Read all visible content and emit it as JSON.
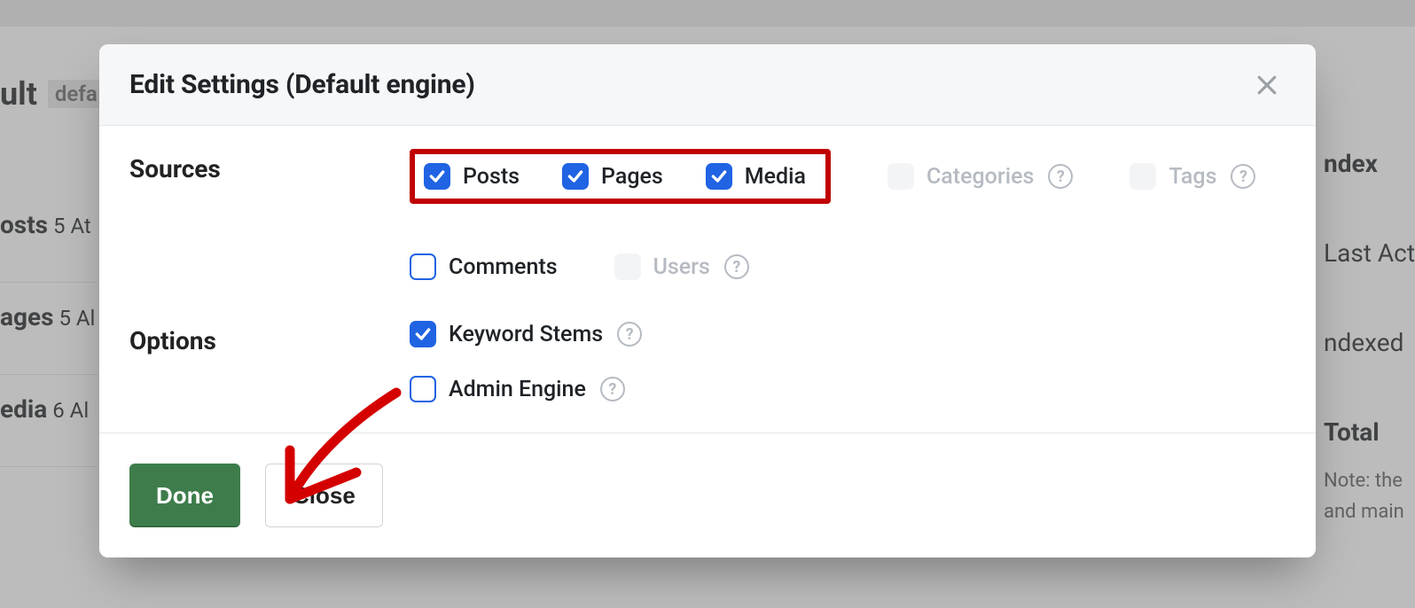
{
  "background": {
    "title_suffix": "ult",
    "badge": "defa",
    "list": [
      {
        "label": "osts",
        "meta": "5 At"
      },
      {
        "label": "ages",
        "meta": "5 Al"
      },
      {
        "label": "edia",
        "meta": "6 Al"
      }
    ],
    "right": {
      "l1": "ndex",
      "l2": "Last Act",
      "l3": "ndexed",
      "l4": "Total",
      "note1": "Note: the",
      "note2": "and main"
    }
  },
  "modal": {
    "title": "Edit Settings (Default engine)",
    "sections": {
      "sources_label": "Sources",
      "options_label": "Options"
    },
    "sources": {
      "posts": {
        "label": "Posts",
        "checked": true,
        "disabled": false,
        "help": false
      },
      "pages": {
        "label": "Pages",
        "checked": true,
        "disabled": false,
        "help": false
      },
      "media": {
        "label": "Media",
        "checked": true,
        "disabled": false,
        "help": false
      },
      "categories": {
        "label": "Categories",
        "checked": false,
        "disabled": true,
        "help": true
      },
      "tags": {
        "label": "Tags",
        "checked": false,
        "disabled": true,
        "help": true
      },
      "comments": {
        "label": "Comments",
        "checked": false,
        "disabled": false,
        "help": false
      },
      "users": {
        "label": "Users",
        "checked": false,
        "disabled": true,
        "help": true
      }
    },
    "options": {
      "keyword_stems": {
        "label": "Keyword Stems",
        "checked": true,
        "help": true
      },
      "admin_engine": {
        "label": "Admin Engine",
        "checked": false,
        "help": true
      }
    },
    "buttons": {
      "done": "Done",
      "close": "Close"
    }
  }
}
